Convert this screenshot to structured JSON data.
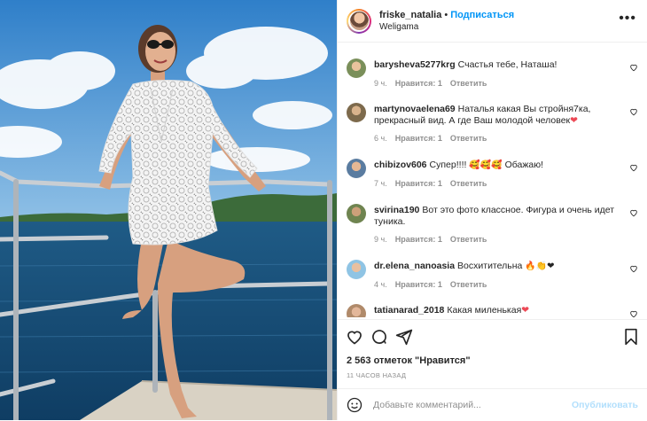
{
  "post": {
    "username": "friske_natalia",
    "separator": "•",
    "follow_label": "Подписаться",
    "location": "Weligama"
  },
  "comments": [
    {
      "user": "barysheva5277krg",
      "text": "Счастья тебе, Наташа!",
      "time": "9 ч.",
      "likes": "Нравится: 1",
      "reply": "Ответить"
    },
    {
      "user": "martynovaelena69",
      "text": "Наталья какая Вы стройня7ка, прекрасный вид. А где Ваш молодой человек",
      "emoji": "❤",
      "time": "6 ч.",
      "likes": "Нравится: 1",
      "reply": "Ответить"
    },
    {
      "user": "chibizov606",
      "text": "Супер!!!! ",
      "emoji": "🥰🥰🥰",
      "text2": " Обажаю!",
      "time": "7 ч.",
      "likes": "Нравится: 1",
      "reply": "Ответить"
    },
    {
      "user": "svirina190",
      "text": "Вот это фото классное. Фигура и очень идет туника.",
      "time": "9 ч.",
      "likes": "Нравится: 1",
      "reply": "Ответить"
    },
    {
      "user": "dr.elena_nanoasia",
      "text": "Восхитительна ",
      "emoji": "🔥👏❤",
      "time": "4 ч.",
      "likes": "Нравится: 1",
      "reply": "Ответить"
    },
    {
      "user": "tatianarad_2018",
      "text": "Какая миленькая",
      "emoji": "❤"
    }
  ],
  "likes_count": "2 563 отметок \"Нравится\"",
  "timestamp": "11 ЧАСОВ НАЗАД",
  "add_comment": {
    "placeholder": "Добавьте комментарий...",
    "publish_label": "Опубликовать"
  },
  "icons": {
    "more": "more-horizontal-icon",
    "like": "heart-icon",
    "comment": "comment-icon",
    "share": "paper-plane-icon",
    "save": "bookmark-icon",
    "emoji": "smiley-icon"
  },
  "colors": {
    "accent": "#0095f6",
    "muted": "#8e8e8e",
    "border": "#efefef",
    "publish_disabled": "#b2dffc"
  }
}
